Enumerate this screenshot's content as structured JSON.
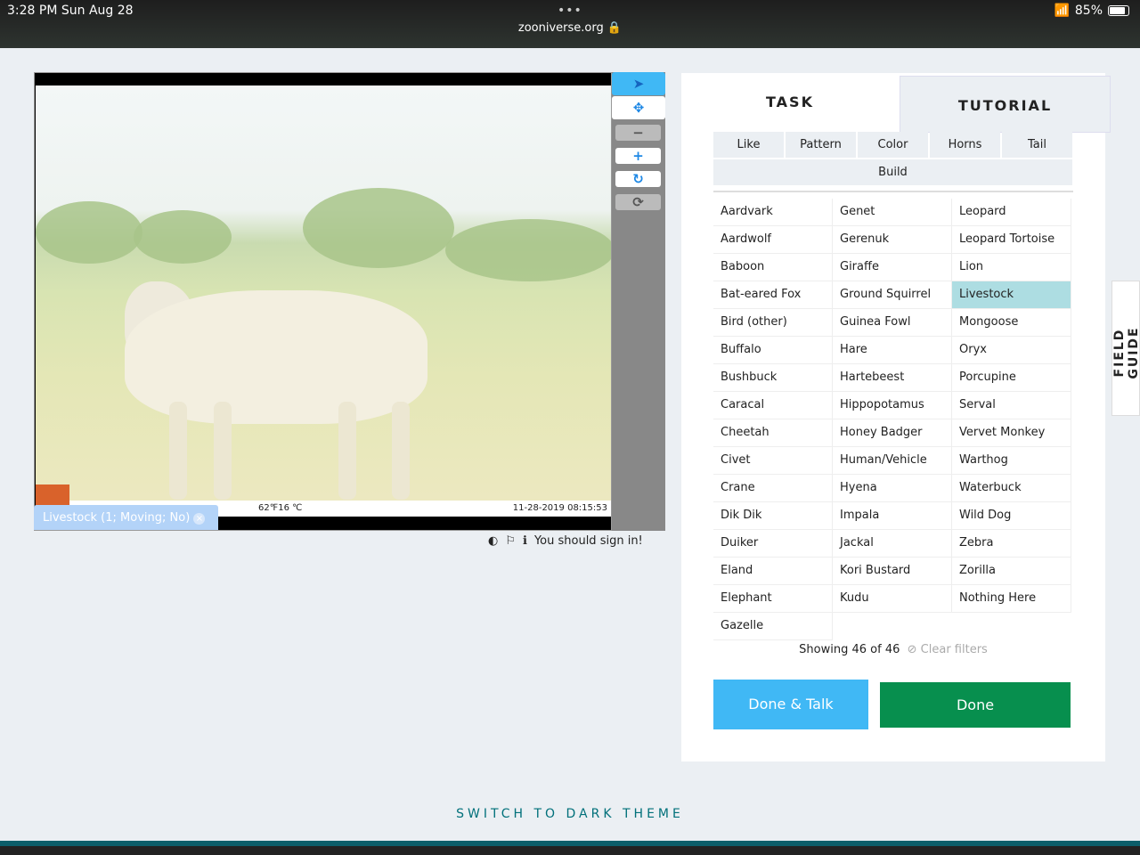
{
  "status": {
    "time": "3:28 PM   Sun Aug 28",
    "url": "zooniverse.org 🔒",
    "battery": "85%",
    "battery_level": 0.85
  },
  "viewer": {
    "temperature": "62℉16 ℃",
    "timestamp": "11-28-2019 08:15:53",
    "annotation_label": "Livestock (1; Moving; No)",
    "close_icon": "×"
  },
  "toolbar": {
    "tools": [
      "pointer-icon",
      "move-icon",
      "zoom-out-icon",
      "zoom-in-icon",
      "rotate-icon",
      "reset-icon"
    ],
    "glyphs": [
      "➤",
      "✥",
      "−",
      "+",
      "↻",
      "⟳"
    ]
  },
  "signin": {
    "text": "You should sign in!"
  },
  "panel": {
    "tabs": {
      "task": "TASK",
      "tutorial": "TUTORIAL"
    },
    "filters": [
      "Like",
      "Pattern",
      "Color",
      "Horns",
      "Tail",
      "Build"
    ],
    "species": [
      "Aardvark",
      "Aardwolf",
      "Baboon",
      "Bat-eared Fox",
      "Bird (other)",
      "Buffalo",
      "Bushbuck",
      "Caracal",
      "Cheetah",
      "Civet",
      "Crane",
      "Dik Dik",
      "Duiker",
      "Eland",
      "Elephant",
      "Gazelle",
      "Genet",
      "Gerenuk",
      "Giraffe",
      "Ground Squirrel",
      "Guinea Fowl",
      "Hare",
      "Hartebeest",
      "Hippopotamus",
      "Honey Badger",
      "Human/Vehicle",
      "Hyena",
      "Impala",
      "Jackal",
      "Kori Bustard",
      "Kudu",
      "Leopard",
      "Leopard Tortoise",
      "Lion",
      "Livestock",
      "Mongoose",
      "Oryx",
      "Porcupine",
      "Serval",
      "Vervet Monkey",
      "Warthog",
      "Waterbuck",
      "Wild Dog",
      "Zebra",
      "Zorilla",
      "Nothing Here"
    ],
    "selected": "Livestock",
    "showing": "Showing 46 of 46",
    "clear_filters": "⊘ Clear filters",
    "done_talk": "Done & Talk",
    "done": "Done"
  },
  "field_guide": "FIELD GUIDE",
  "dark_theme": "SWITCH TO DARK THEME",
  "colors": {
    "selected": "#addde2",
    "done_talk": "#40b8f5",
    "done": "#078f4e",
    "accent": "#00707a"
  }
}
